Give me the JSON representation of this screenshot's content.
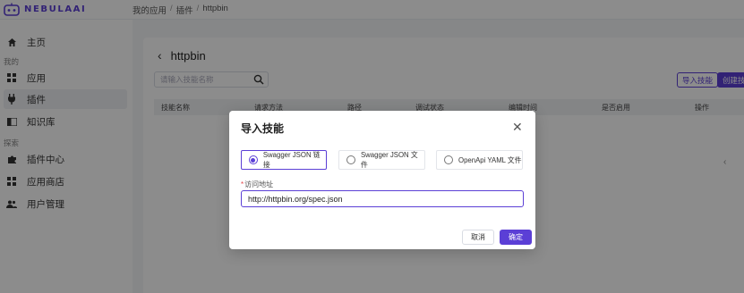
{
  "header": {
    "logo_text": "NEBULAAI",
    "breadcrumb": [
      "我的应用",
      "插件",
      "httpbin"
    ]
  },
  "sidebar": {
    "home": "主页",
    "group_mine": "我的",
    "app": "应用",
    "plugin": "插件",
    "knowledge": "知识库",
    "group_explore": "探索",
    "plugin_center": "插件中心",
    "app_store": "应用商店",
    "user_mgmt": "用户管理"
  },
  "main": {
    "title": "httpbin",
    "search_placeholder": "请输入技能名称",
    "import_label": "导入技能",
    "create_label": "创建技能",
    "columns": [
      "技能名称",
      "请求方法",
      "路径",
      "调试状态",
      "编辑时间",
      "是否启用",
      "操作"
    ]
  },
  "modal": {
    "title": "导入技能",
    "options": [
      "Swagger JSON 链接",
      "Swagger JSON 文件",
      "OpenApi YAML 文件"
    ],
    "selected_index": 0,
    "field_label": "访问地址",
    "field_required": "*",
    "url_value": "http://httpbin.org/spec.json",
    "cancel_label": "取消",
    "ok_label": "确定"
  },
  "colors": {
    "accent": "#5b3fd6",
    "required": "#e5484d"
  }
}
